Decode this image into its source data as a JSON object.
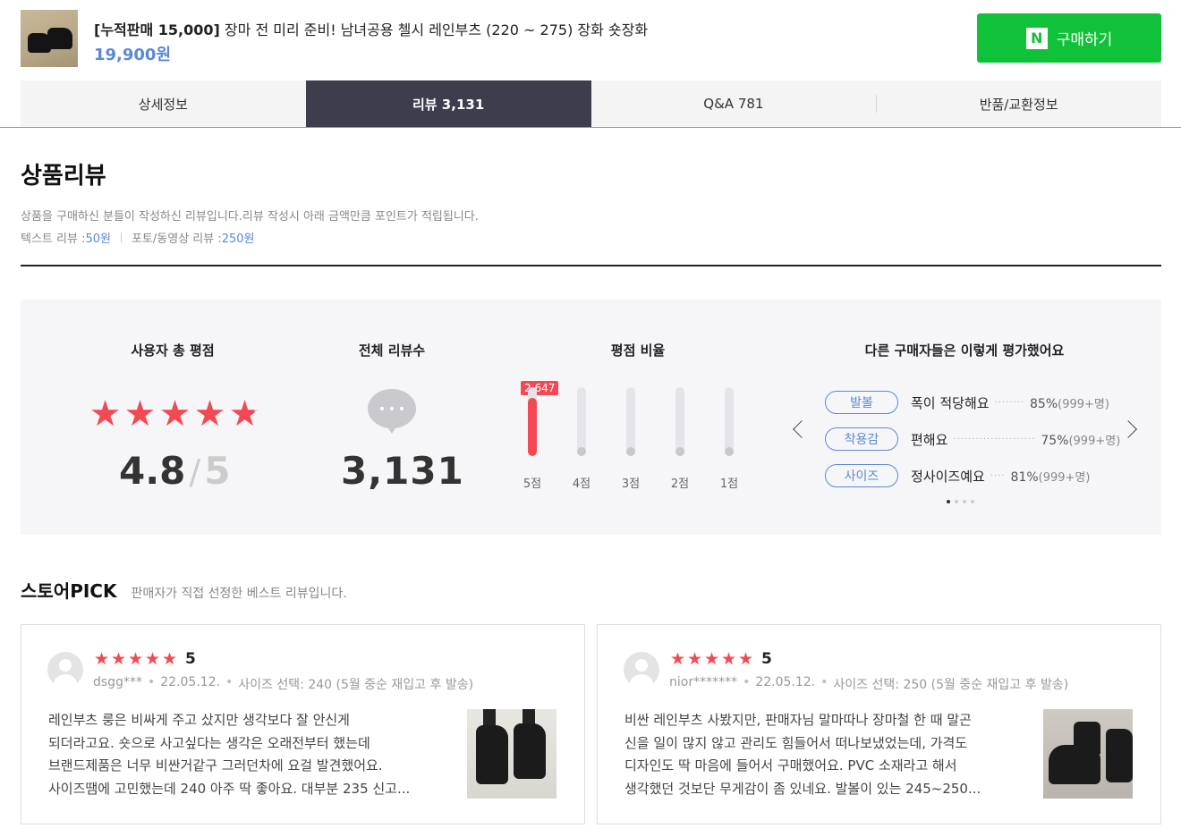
{
  "product": {
    "title_bracket": "[누적판매 15,000]",
    "title_rest": " 장마 전 미리 준비! 남녀공용 첼시 레인부츠 (220 ~ 275) 장화 숏장화",
    "price": "19,900원",
    "buy_logo": "N",
    "buy_label": "구매하기"
  },
  "tabs": [
    {
      "label": "상세정보",
      "active": false
    },
    {
      "label": "리뷰 3,131",
      "active": true
    },
    {
      "label": "Q&A 781",
      "active": false
    },
    {
      "label": "반품/교환정보",
      "active": false
    }
  ],
  "review": {
    "heading": "상품리뷰",
    "description": "상품을 구매하신 분들이 작성하신 리뷰입니다.리뷰 작성시 아래 금액만큼 포인트가 적립됩니다.",
    "text_review_label": "텍스트 리뷰 : ",
    "text_review_point": "50원",
    "photo_review_label": "포토/동영상 리뷰 : ",
    "photo_review_point": "250원"
  },
  "summary": {
    "rating_title": "사용자 총 평점",
    "rating": "4.8",
    "rating_sep": "/",
    "rating_max": "5",
    "rating_value": 4.8,
    "count_title": "전체 리뷰수",
    "count": "3,131",
    "ratio_title": "평점 비율",
    "ratio_top_badge": "2,647",
    "ratio": [
      {
        "label": "5점",
        "fraction": 0.85
      },
      {
        "label": "4점",
        "fraction": 0.0
      },
      {
        "label": "3점",
        "fraction": 0.0
      },
      {
        "label": "2점",
        "fraction": 0.0
      },
      {
        "label": "1점",
        "fraction": 0.0
      }
    ],
    "eval_title": "다른 구매자들은 이렇게 평가했어요",
    "evaluations": [
      {
        "tag": "발볼",
        "value": "폭이 적당해요",
        "percent": "85%",
        "count": "(999+명)"
      },
      {
        "tag": "착용감",
        "value": "편해요",
        "percent": "75%",
        "count": "(999+명)"
      },
      {
        "tag": "사이즈",
        "value": "정사이즈예요",
        "percent": "81%",
        "count": "(999+명)"
      }
    ],
    "pager_count": 4,
    "pager_active": 0
  },
  "store_pick": {
    "title": "스토어PICK",
    "subtitle": "판매자가 직접 선정한 베스트 리뷰입니다."
  },
  "reviews": [
    {
      "score": "5",
      "user": "dsgg***",
      "date": "22.05.12.",
      "option": "사이즈 선택: 240 (5월 중순 재입고 후 발송)",
      "lines": [
        "레인부츠 룽은 비싸게 주고 샀지만 생각보다 잘 안신게",
        "되더라고요. 숏으로 사고싶다는 생각은 오래전부터 했는데",
        "브랜드제품은 너무 비싼거같구 그러던차에 요걸 발견했어요.",
        "사이즈땜에 고민했는데 240 아주 딱 좋아요. 대부분 235 신고..."
      ]
    },
    {
      "score": "5",
      "user": "nior*******",
      "date": "22.05.12.",
      "option": "사이즈 선택: 250 (5월 중순 재입고 후 발송)",
      "lines": [
        "비싼 레인부츠 사봤지만, 판매자님 말마따나 장마철 한 때 말곤",
        "신을 일이 많지 않고 관리도 힘들어서 떠나보냈었는데, 가격도",
        "디자인도 딱 마음에 들어서 구매했어요. PVC 소재라고 해서",
        "생각했던 것보단 무게감이 좀 있네요. 발볼이 있는 245~250..."
      ]
    }
  ],
  "colors": {
    "accent_red": "#f24953",
    "naver_green": "#10c23a",
    "link_blue": "#5b89d6",
    "tab_active": "#3c3e4d"
  }
}
